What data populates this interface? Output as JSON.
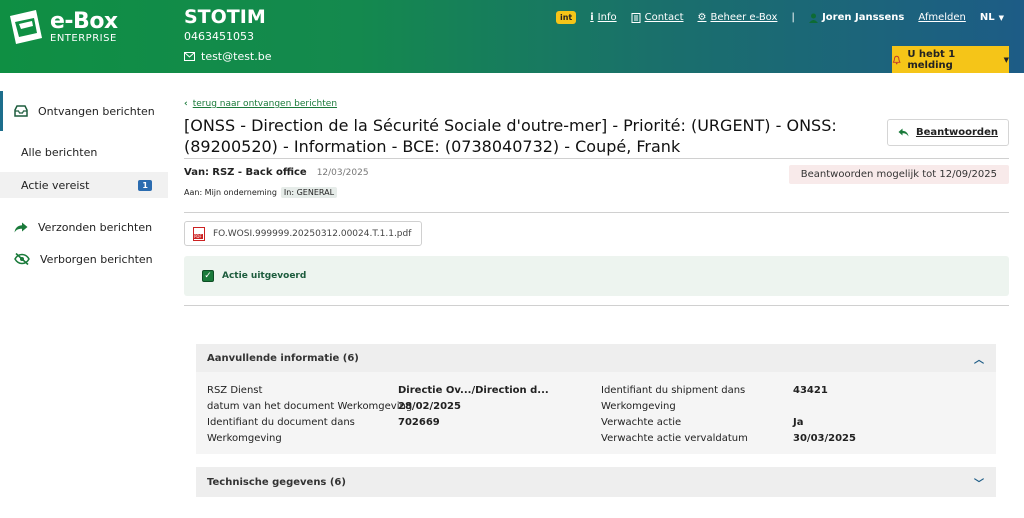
{
  "header": {
    "logo_text": "e-Box",
    "logo_sub": "ENTERPRISE",
    "company_name": "STOTIM",
    "company_number": "0463451053",
    "company_email": "test@test.be",
    "env_badge": "int",
    "nav_info": "Info",
    "nav_contact": "Contact",
    "nav_manage": "Beheer e-Box",
    "separator": "|",
    "user_name": "Joren Janssens",
    "logout": "Afmelden",
    "language": "NL",
    "notification": "U hebt 1 melding"
  },
  "sidebar": {
    "received": "Ontvangen berichten",
    "all_messages": "Alle berichten",
    "action_required": "Actie vereist",
    "action_count": "1",
    "sent": "Verzonden berichten",
    "hidden": "Verborgen berichten"
  },
  "message": {
    "back_link": "terug naar ontvangen berichten",
    "title": "[ONSS - Direction de la Sécurité Sociale d'outre-mer] - Priorité: (URGENT) - ONSS: (89200520) - Information - BCE: (0738040732) - Coupé, Frank",
    "reply_button": "Beantwoorden",
    "from_label": "Van:",
    "from_value": "RSZ - Back office",
    "date": "12/03/2025",
    "deadline": "Beantwoorden mogelijk tot 12/09/2025",
    "to_label": "Aan: Mijn onderneming",
    "to_tag": "In: GENERAL",
    "attachment": "FO.WOSI.999999.20250312.00024.T.1.1.pdf",
    "action_done": "Actie uitgevoerd"
  },
  "additional": {
    "heading": "Aanvullende informatie (6)",
    "l1": "RSZ Dienst",
    "v1": "Directie Ov.../Direction d...",
    "l2": "datum van het document Werkomgeving",
    "v2": "28/02/2025",
    "l3a": "Identifiant du document dans",
    "l3b": "Werkomgeving",
    "v3": "702669",
    "r1a": "Identifiant du shipment dans",
    "r1b": "Werkomgeving",
    "rv1": "43421",
    "r2": "Verwachte actie",
    "rv2": "Ja",
    "r3": "Verwachte actie vervaldatum",
    "rv3": "30/03/2025"
  },
  "technical": {
    "heading": "Technische gegevens (6)"
  },
  "colors": {
    "brand_green": "#0f8f43",
    "brand_blue": "#1d5c86",
    "notification_yellow": "#f5c518",
    "badge_blue": "#2b6cb0"
  }
}
